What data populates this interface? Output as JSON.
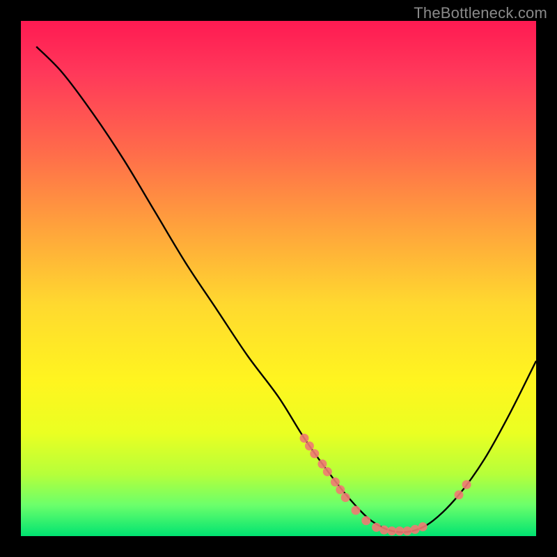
{
  "watermark": "TheBottleneck.com",
  "chart_data": {
    "type": "line",
    "title": "",
    "xlabel": "",
    "ylabel": "",
    "xlim": [
      0,
      100
    ],
    "ylim": [
      0,
      100
    ],
    "note": "No axes or tick labels are rendered in the image; values below are estimated from the plotted curve and marker positions on a 0–100 normalized canvas where y=0 is the top edge and y=100 is the bottom edge of the gradient frame.",
    "series": [
      {
        "name": "curve",
        "x": [
          3,
          8,
          14,
          20,
          26,
          32,
          38,
          44,
          50,
          55,
          60,
          64,
          68,
          72,
          76,
          80,
          85,
          90,
          95,
          100
        ],
        "y": [
          5,
          10,
          18,
          27,
          37,
          47,
          56,
          65,
          73,
          81,
          88,
          93,
          97,
          99,
          99,
          97,
          92,
          85,
          76,
          66
        ]
      }
    ],
    "markers": {
      "name": "highlighted-points",
      "color": "#ef7a72",
      "points": [
        {
          "x": 55,
          "y": 81
        },
        {
          "x": 56,
          "y": 82.5
        },
        {
          "x": 57,
          "y": 84
        },
        {
          "x": 58.5,
          "y": 86
        },
        {
          "x": 59.5,
          "y": 87.5
        },
        {
          "x": 61,
          "y": 89.5
        },
        {
          "x": 62,
          "y": 91
        },
        {
          "x": 63,
          "y": 92.5
        },
        {
          "x": 65,
          "y": 95
        },
        {
          "x": 67,
          "y": 97
        },
        {
          "x": 69,
          "y": 98.3
        },
        {
          "x": 70.5,
          "y": 98.8
        },
        {
          "x": 72,
          "y": 99
        },
        {
          "x": 73.5,
          "y": 99
        },
        {
          "x": 75,
          "y": 99
        },
        {
          "x": 76.5,
          "y": 98.7
        },
        {
          "x": 78,
          "y": 98.2
        },
        {
          "x": 85,
          "y": 92
        },
        {
          "x": 86.5,
          "y": 90
        }
      ]
    }
  }
}
